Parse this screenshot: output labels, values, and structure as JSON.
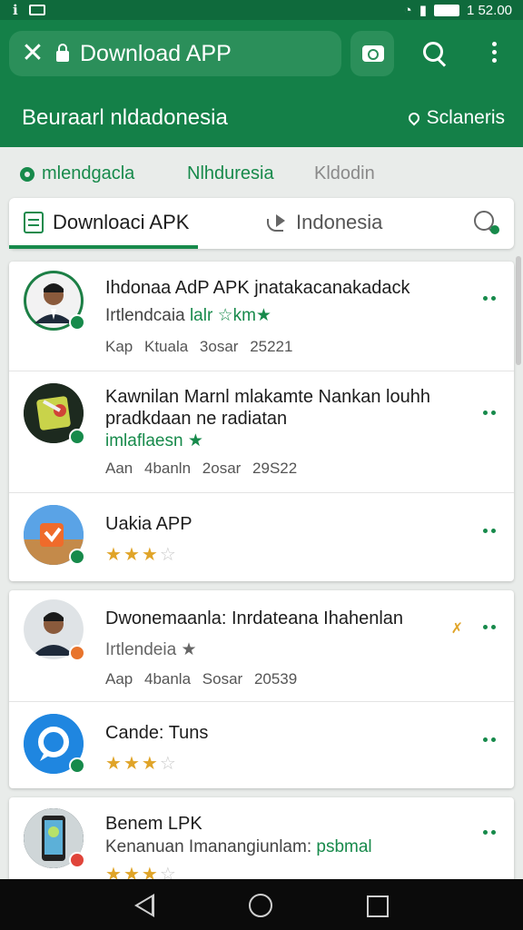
{
  "status_bar": {
    "left_icons": [
      "notification-icon",
      "cast-icon"
    ],
    "time": "1 52.00",
    "right_icons": [
      "wifi-icon",
      "signal-icon",
      "battery-icon"
    ]
  },
  "browser": {
    "close_label": "✕",
    "url_title": "Download APP",
    "icons": [
      "close-icon",
      "lock-icon",
      "camera-icon",
      "search-icon",
      "more-vert-icon"
    ]
  },
  "header": {
    "headline": "Beuraarl nldadonesia",
    "location": "Sclaneris"
  },
  "filters": [
    {
      "label": "mlendgacla"
    },
    {
      "label": "Nlhduresia"
    },
    {
      "label": "Kldodin"
    }
  ],
  "tabs": [
    {
      "label": "Downloaci APK",
      "icon": "document-icon",
      "active": true
    },
    {
      "label": "Indonesia",
      "icon": "share-icon",
      "active": false
    },
    {
      "label": "",
      "icon": "search-add-icon",
      "active": false
    }
  ],
  "list": [
    {
      "title": "Ihdonaa AdP APK jnatakacanakadack",
      "subtitle": "Irtlendcaia",
      "subtitle_green": "lalr ☆km★",
      "meta": [
        "Kap",
        "Ktuala",
        "3osar",
        "25221"
      ],
      "badge_color": "#178a4b"
    },
    {
      "title": "Kawnilan Marnl mlakamte Nankan louhh",
      "title2": "pradkdaan ne radiatan",
      "subtitle_green": "imlaflaesn ★",
      "meta": [
        "Aan",
        "4banln",
        "2osar",
        "29S22"
      ],
      "badge_color": "#178a4b"
    },
    {
      "title": "Uakia APP",
      "rating": 3.5,
      "badge_color": "#178a4b"
    },
    {
      "title": "Dwonemaanla: Inrdateana Ihahenlan",
      "subtitle": "Irtlendeia ★",
      "meta": [
        "Aap",
        "4banla",
        "Sosar",
        "20539"
      ],
      "badge_color": "#e8742c"
    },
    {
      "title": "Cande: Tuns",
      "rating": 3.5,
      "badge_color": "#178a4b"
    },
    {
      "title": "Benem LPK",
      "subtitle": "Kenanuan Imanangiunlam:",
      "subtitle_green": "psbmal",
      "rating": 3.5,
      "badge_color": "#e0443a"
    }
  ],
  "colors": {
    "primary": "#148048",
    "accent_green": "#178a4b",
    "star": "#e0a428"
  },
  "nav_bar": [
    "back-icon",
    "home-icon",
    "recents-icon"
  ]
}
